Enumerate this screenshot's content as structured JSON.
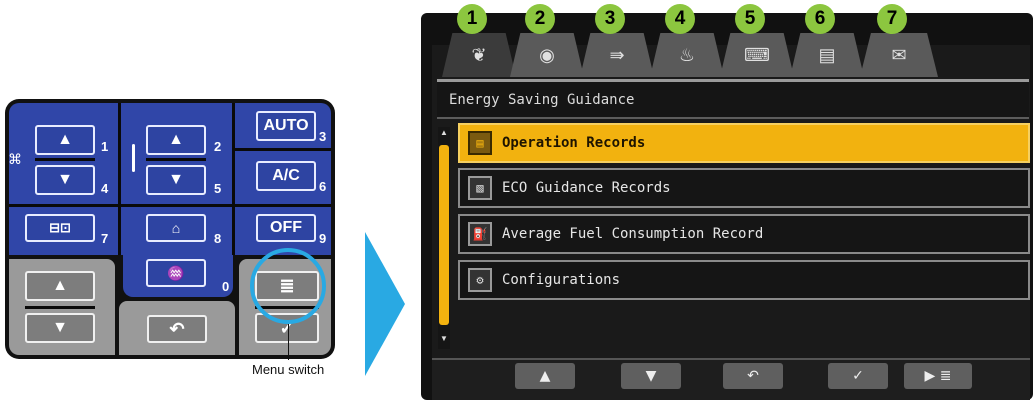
{
  "panel": {
    "fan_up": "▲",
    "fan_down": "▼",
    "fan_key_up": "1",
    "fan_key_down": "4",
    "temp_up": "▲",
    "temp_down": "▼",
    "temp_key_up": "2",
    "temp_key_down": "5",
    "auto_label": "AUTO",
    "auto_key": "3",
    "ac_label": "A/C",
    "ac_key": "6",
    "off_label": "OFF",
    "off_key": "9",
    "mode_key": "7",
    "airflow_key": "8",
    "defrost_key": "0",
    "left_up": "▲",
    "left_down": "▼",
    "back_symbol": "↶",
    "menu_symbol": "≣",
    "check_symbol": "✓",
    "fan_glyph": "⌘",
    "temp_glyph": "🌡"
  },
  "callout": {
    "label": "Menu switch"
  },
  "screen": {
    "tab_numbers": [
      "1",
      "2",
      "3",
      "4",
      "5",
      "6",
      "7"
    ],
    "tab_icons": [
      "leaf-icon",
      "gauge-icon",
      "fuel-arrow-icon",
      "driver-icon",
      "car-icon",
      "menu-icon",
      "mail-icon"
    ],
    "active_tab": 0,
    "title": "Energy Saving Guidance",
    "menu_items": [
      {
        "label": "Operation Records",
        "selected": true
      },
      {
        "label": "ECO Guidance Records",
        "selected": false
      },
      {
        "label": "Average Fuel Consumption Record",
        "selected": false
      },
      {
        "label": "Configurations",
        "selected": false
      }
    ],
    "bottom_buttons": [
      "▲",
      "▼",
      "↶",
      "✓",
      "▶ ≣"
    ]
  },
  "colors": {
    "accent_blue": "#29a9e3",
    "selected_yellow": "#f2b20f",
    "tab_badge_green": "#8cc63f",
    "panel_blue": "#3046a8"
  }
}
